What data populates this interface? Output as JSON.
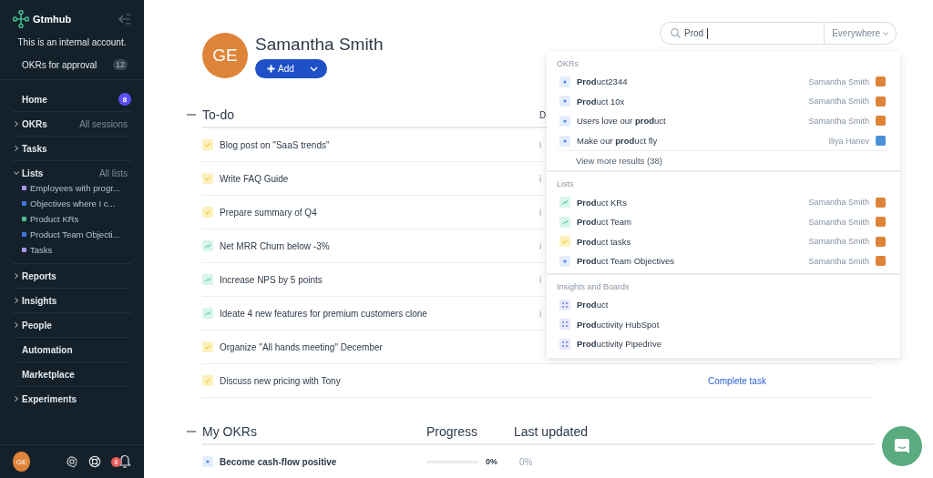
{
  "sidebar": {
    "brand": "Gtmhub",
    "notice": "This is an internal account.",
    "approval": {
      "label": "OKRs for approval",
      "count": "12"
    },
    "items": [
      {
        "label": "Home",
        "badge": "8"
      },
      {
        "label": "OKRs",
        "hint": "All sessions",
        "expanded": false
      },
      {
        "label": "Tasks",
        "expanded": false
      },
      {
        "label": "Lists",
        "hint": "All lists",
        "expanded": true,
        "children": [
          {
            "label": "Employees with progr...",
            "color": "#a997f0"
          },
          {
            "label": "Objectives where I c...",
            "color": "#3d7be0"
          },
          {
            "label": "Product KRs",
            "color": "#4cc08a"
          },
          {
            "label": "Product Team Objecti...",
            "color": "#3d7be0"
          },
          {
            "label": "Tasks",
            "color": "#a997f0"
          }
        ]
      },
      {
        "label": "Reports",
        "expanded": false
      },
      {
        "label": "Insights",
        "expanded": false
      },
      {
        "label": "People",
        "expanded": false
      },
      {
        "label": "Automation"
      },
      {
        "label": "Marketplace"
      },
      {
        "label": "Experiments",
        "expanded": false
      }
    ],
    "footer": {
      "avatar": "GE",
      "notifications": "8"
    }
  },
  "profile": {
    "initials": "GE",
    "name": "Samantha Smith",
    "add_button": "Add"
  },
  "todo": {
    "title": "To-do",
    "column_2": "D",
    "rows": [
      {
        "kind": "task",
        "title": "Blog post on \"SaaS trends\"",
        "column_2": "i"
      },
      {
        "kind": "task",
        "title": "Write FAQ Guide",
        "column_2": "i"
      },
      {
        "kind": "task",
        "title": "Prepare summary of Q4",
        "column_2": "i"
      },
      {
        "kind": "kr",
        "title": "Net MRR Churn below -3%",
        "column_2": "i"
      },
      {
        "kind": "kr",
        "title": "Increase NPS by 5 points",
        "column_2": "i"
      },
      {
        "kind": "kr",
        "title": "Ideate 4 new features for premium customers clone",
        "column_2": "i"
      },
      {
        "kind": "task",
        "title": "Organize \"All hands meeting\" December"
      },
      {
        "kind": "task",
        "title": "Discuss new pricing with Tony",
        "action": "Complete task"
      }
    ]
  },
  "my_okrs": {
    "title": "My OKRs",
    "columns": [
      "Progress",
      "Last updated"
    ],
    "rows": [
      {
        "kind": "objective",
        "title": "Become cash-flow positive",
        "level": 0,
        "progress": "0%",
        "last_updated": "0%"
      }
    ]
  },
  "search": {
    "value": "Prod",
    "scope": "Everywhere",
    "groups": [
      {
        "title": "OKRs",
        "items": [
          {
            "kind": "objective",
            "label": "**Prod**uct2344",
            "owner": "Samantha Smith",
            "color": "#de8438"
          },
          {
            "kind": "objective",
            "label": "**Prod**uct 10x",
            "owner": "Samantha Smith",
            "color": "#de8438"
          },
          {
            "kind": "objective",
            "label": "Users love our **prod**uct",
            "owner": "Samantha Smith",
            "color": "#de8438"
          },
          {
            "kind": "objective",
            "label": "Make our **prod**uct fly",
            "owner": "Iliya Hanev",
            "color": "#4a90d9"
          }
        ],
        "more": "View more results (38)"
      },
      {
        "title": "Lists",
        "items": [
          {
            "kind": "kr",
            "label": "**Prod**uct KRs",
            "owner": "Samantha Smith",
            "color": "#de8438"
          },
          {
            "kind": "kr",
            "label": "**Prod**uct Team",
            "owner": "Samantha Smith",
            "color": "#de8438"
          },
          {
            "kind": "task",
            "label": "**Prod**uct tasks",
            "owner": "Samantha Smith",
            "color": "#de8438"
          },
          {
            "kind": "objective",
            "label": "**Prod**uct Team Objectives",
            "owner": "Samantha Smith",
            "color": "#de8438"
          }
        ]
      },
      {
        "title": "Insights and Boards",
        "items": [
          {
            "kind": "board",
            "label": "**Prod**uct"
          },
          {
            "kind": "board",
            "label": "**Prod**uctivity HubSpot"
          },
          {
            "kind": "board",
            "label": "**Prod**uctivity Pipedrive"
          }
        ]
      }
    ]
  }
}
